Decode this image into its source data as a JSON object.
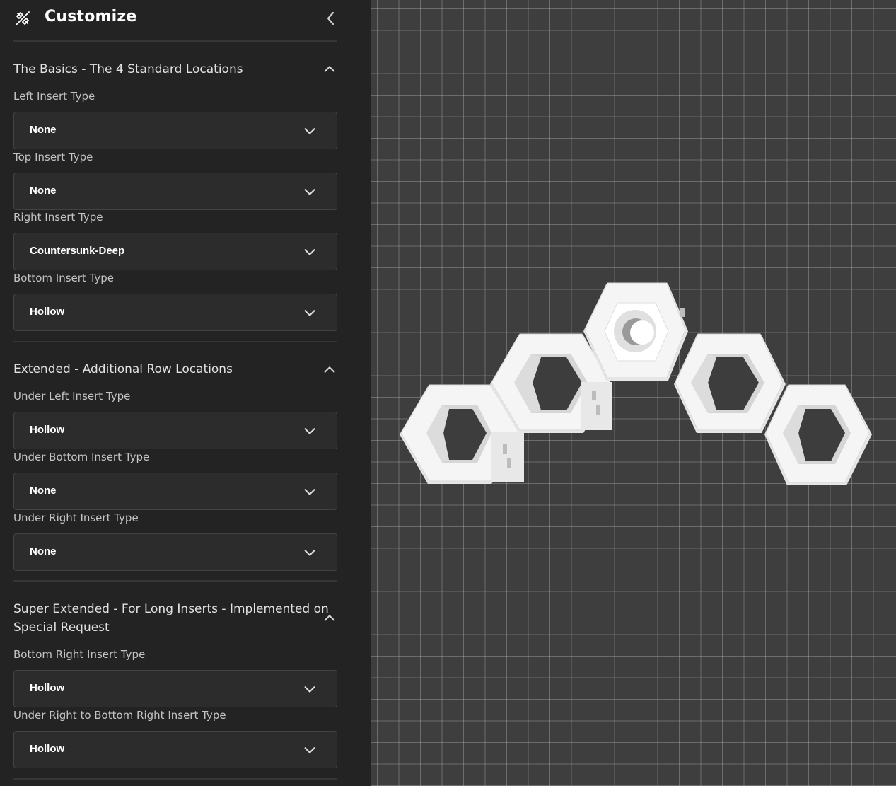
{
  "header": {
    "title": "Customize",
    "icon": "paint-brush-icon",
    "collapse_icon": "chevron-left-icon"
  },
  "sections": [
    {
      "title": "The Basics - The 4 Standard Locations",
      "fields": [
        {
          "label": "Left Insert Type",
          "value": "None"
        },
        {
          "label": "Top Insert Type",
          "value": "None"
        },
        {
          "label": "Right Insert Type",
          "value": "Countersunk-Deep"
        },
        {
          "label": "Bottom Insert Type",
          "value": "Hollow"
        }
      ]
    },
    {
      "title": "Extended - Additional Row Locations",
      "fields": [
        {
          "label": "Under Left Insert Type",
          "value": "Hollow"
        },
        {
          "label": "Under Bottom Insert Type",
          "value": "None"
        },
        {
          "label": "Under Right Insert Type",
          "value": "None"
        }
      ]
    },
    {
      "title_line1": "Super Extended - For Long Inserts - Implemented on",
      "title_line2": "Special Request",
      "fields": [
        {
          "label": "Bottom Right Insert Type",
          "value": "Hollow"
        },
        {
          "label": "Under Right to Bottom Right Insert Type",
          "value": "Hollow"
        }
      ]
    }
  ],
  "colors": {
    "sidebar_bg": "#232323",
    "select_bg": "#2c2c2c",
    "viewport_bg": "#3e3e3e",
    "model": "#f4f4f4"
  }
}
